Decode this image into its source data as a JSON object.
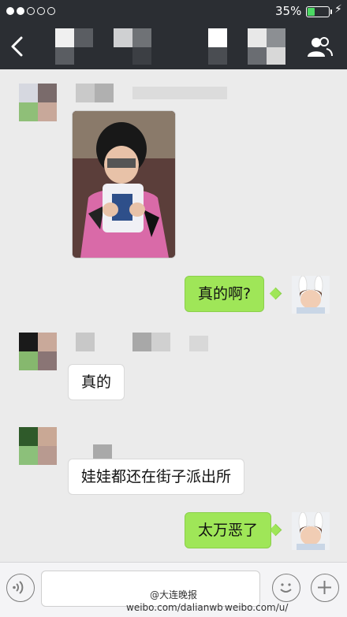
{
  "status_bar": {
    "battery_percent_text": "35%",
    "battery_level": 0.35,
    "charging_symbol": "⚡"
  },
  "header": {
    "back_icon": "chevron-left-icon",
    "title": "",
    "contacts_icon": "contacts-icon"
  },
  "messages": [
    {
      "direction": "incoming",
      "type": "image",
      "sender": "",
      "image_subject": "child holding a bag"
    },
    {
      "direction": "outgoing",
      "type": "text",
      "text": "真的啊?"
    },
    {
      "direction": "incoming",
      "type": "text",
      "text": "真的"
    },
    {
      "direction": "incoming",
      "type": "text",
      "text": "娃娃都还在街子派出所"
    },
    {
      "direction": "outgoing",
      "type": "text",
      "text": "太万恶了"
    }
  ],
  "input_bar": {
    "voice_icon": "voice-icon",
    "emoji_icon": "emoji-icon",
    "plus_icon": "plus-icon"
  },
  "watermarks": {
    "line1": "@大连晚报",
    "line2": "weibo.com/dalianwb",
    "line3": "weibo.com/u/"
  },
  "colors": {
    "header_bg": "#2b2e33",
    "outgoing_bubble": "#9fe658",
    "incoming_bubble": "#ffffff",
    "chat_bg": "#ebebeb",
    "battery_fill": "#4cd964"
  }
}
